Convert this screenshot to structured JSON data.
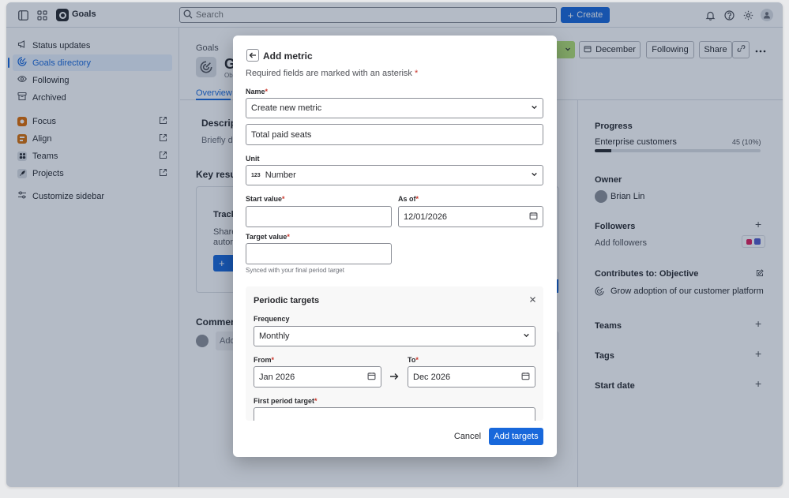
{
  "topbar": {
    "app_name": "Goals",
    "search_placeholder": "Search",
    "create_label": "Create"
  },
  "sidebar": {
    "items": [
      {
        "label": "Status updates",
        "icon": "megaphone-icon"
      },
      {
        "label": "Goals directory",
        "icon": "goal-target-icon",
        "active": true
      },
      {
        "label": "Following",
        "icon": "eye-icon"
      },
      {
        "label": "Archived",
        "icon": "archive-icon"
      }
    ],
    "apps": [
      {
        "label": "Focus",
        "color": "#e06c00"
      },
      {
        "label": "Align",
        "color": "#d97008"
      },
      {
        "label": "Teams",
        "color": "#dcdfe4"
      },
      {
        "label": "Projects",
        "color": "#dcdfe4"
      }
    ],
    "customize_label": "Customize sidebar"
  },
  "page": {
    "breadcrumb": "Goals",
    "title_initial": "G",
    "subtitle_partial": "Ob",
    "tab_overview": "Overview",
    "description_heading": "Descrip",
    "description_placeholder": "Briefly de",
    "key_results_heading": "Key resu",
    "track_heading": "Track",
    "track_text_1": "Share",
    "track_text_2": "autom",
    "comments_heading": "Commen",
    "comment_placeholder": "Add",
    "month_button": "December",
    "following_button": "Following",
    "share_button": "Share"
  },
  "right_panel": {
    "progress_heading": "Progress",
    "progress_label": "Enterprise customers",
    "progress_value": "45 (10%)",
    "progress_fraction": 0.1,
    "owner_heading": "Owner",
    "owner_name": "Brian Lin",
    "followers_heading": "Followers",
    "add_followers": "Add followers",
    "contributes_heading": "Contributes to: Objective",
    "contributes_item": "Grow adoption of our customer platform",
    "teams_heading": "Teams",
    "tags_heading": "Tags",
    "start_date_heading": "Start date"
  },
  "modal": {
    "title": "Add metric",
    "required_note": "Required fields are marked with an asterisk",
    "asterisk": "*",
    "name_label": "Name",
    "name_select_value": "Create new metric",
    "name_input_value": "Total paid seats",
    "unit_label": "Unit",
    "unit_icon_text": "123",
    "unit_value": "Number",
    "start_value_label": "Start value",
    "as_of_label": "As of",
    "as_of_value": "12/01/2026",
    "target_value_label": "Target value",
    "target_helper": "Synced with your final period target",
    "periodic": {
      "title": "Periodic targets",
      "frequency_label": "Frequency",
      "frequency_value": "Monthly",
      "from_label": "From",
      "from_value": "Jan 2026",
      "to_label": "To",
      "to_value": "Dec 2026",
      "first_period_label": "First period target"
    },
    "cancel_label": "Cancel",
    "submit_label": "Add targets"
  },
  "colors": {
    "brand_blue": "#1868db",
    "required_red": "#c9372c",
    "text": "#292a2e"
  }
}
